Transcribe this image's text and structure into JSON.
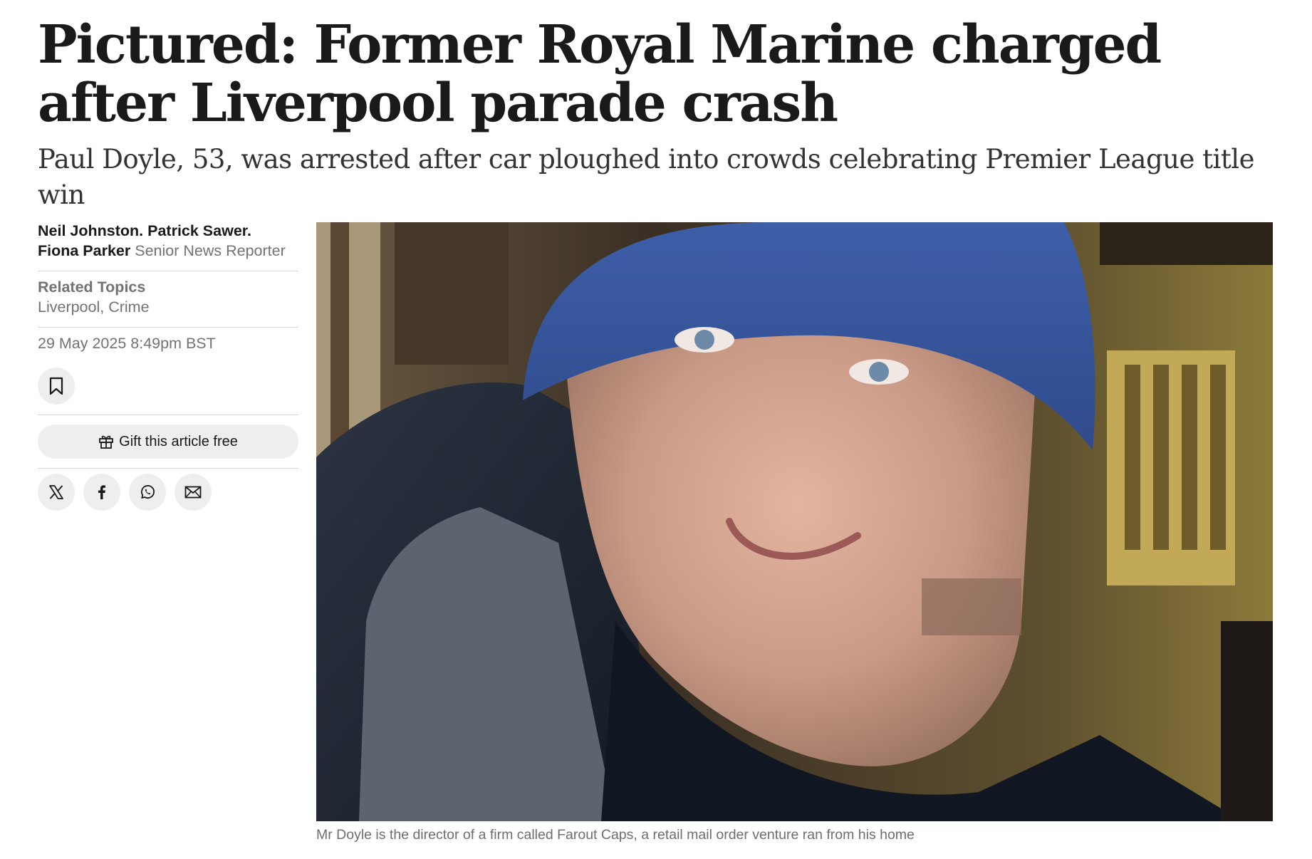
{
  "article": {
    "headline": "Pictured: Former Royal Marine charged after Liverpool parade crash",
    "standfirst": "Paul Doyle, 53, was arrested after car ploughed into crowds celebrating Premier League title win",
    "authors": [
      {
        "name": "Neil Johnston."
      },
      {
        "name": "Patrick Sawer."
      },
      {
        "name": "Fiona Parker",
        "role": "Senior News Reporter"
      }
    ],
    "related_topics": {
      "label": "Related Topics",
      "value": "Liverpool, Crime"
    },
    "date": "29 May 2025 8:49pm BST",
    "gift_label": "Gift this article free",
    "image": {
      "caption": "Mr Doyle is the director of a firm called Farout Caps, a retail mail order venture ran from his home"
    }
  },
  "icons": {
    "save": "bookmark-icon",
    "gift": "gift-icon",
    "share": [
      "x-icon",
      "facebook-icon",
      "whatsapp-icon",
      "email-icon"
    ]
  },
  "colors": {
    "text": "#1a1a1a",
    "muted": "#737373",
    "button_bg": "#eeeeee",
    "rule": "#d9d9d9"
  }
}
